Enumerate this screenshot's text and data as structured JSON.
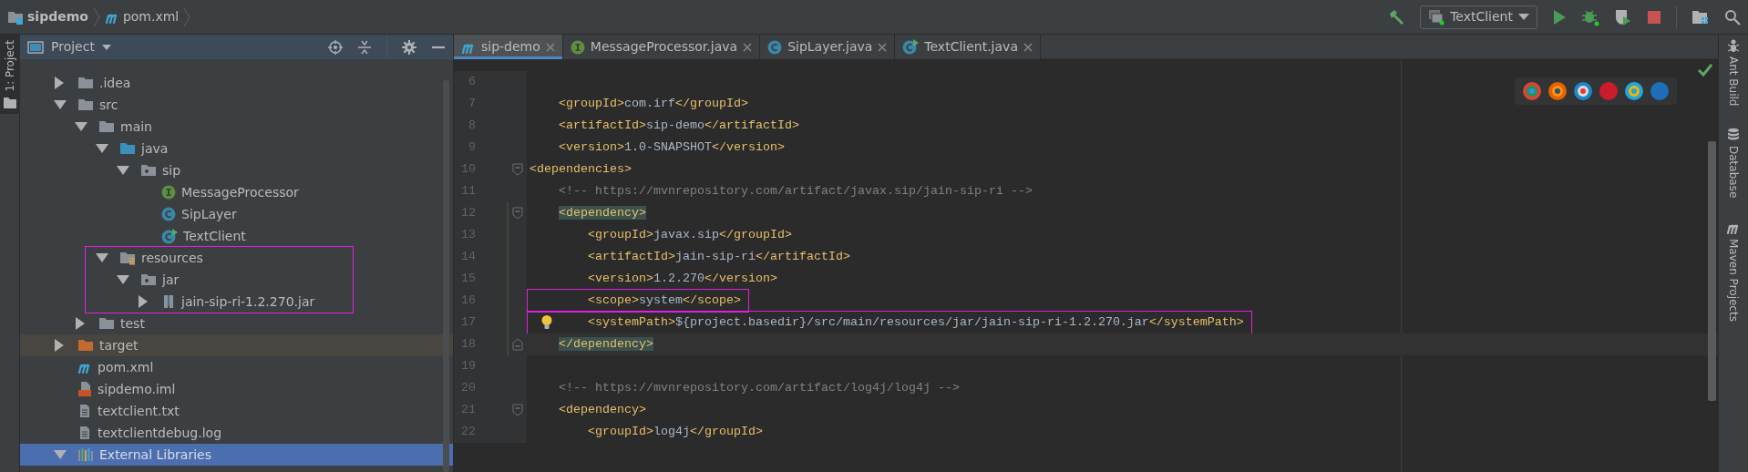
{
  "breadcrumbs": [
    {
      "label": "sipdemo",
      "kind": "project"
    },
    {
      "label": "pom.xml",
      "kind": "maven"
    }
  ],
  "toolbar": {
    "run_config": "TextClient"
  },
  "left_tool_windows": [
    {
      "label": "1: Project",
      "selected": true
    }
  ],
  "project_panel": {
    "title": "Project",
    "tree": [
      {
        "label": ".idea",
        "kind": "folder",
        "expanded": false,
        "selected": false
      },
      {
        "label": "src",
        "kind": "folder",
        "expanded": true,
        "selected": false,
        "children": [
          {
            "label": "main",
            "kind": "folder",
            "expanded": true,
            "selected": false,
            "children": [
              {
                "label": "java",
                "kind": "source-folder",
                "expanded": true,
                "selected": false,
                "children": [
                  {
                    "label": "sip",
                    "kind": "package",
                    "expanded": true,
                    "selected": false,
                    "children": [
                      {
                        "label": "MessageProcessor",
                        "kind": "interface",
                        "selected": false
                      },
                      {
                        "label": "SipLayer",
                        "kind": "class",
                        "selected": false
                      },
                      {
                        "label": "TextClient",
                        "kind": "main-class",
                        "selected": false
                      }
                    ]
                  }
                ]
              },
              {
                "label": "resources",
                "kind": "resources",
                "expanded": true,
                "selected": false,
                "marked": true,
                "children": [
                  {
                    "label": "jar",
                    "kind": "package",
                    "expanded": true,
                    "selected": false,
                    "children": [
                      {
                        "label": "jain-sip-ri-1.2.270.jar",
                        "kind": "jar",
                        "expanded": false,
                        "selected": false
                      }
                    ]
                  }
                ]
              }
            ]
          },
          {
            "label": "test",
            "kind": "folder",
            "expanded": false,
            "selected": false
          }
        ]
      },
      {
        "label": "target",
        "kind": "excluded-folder",
        "expanded": false,
        "selected": false
      },
      {
        "label": "pom.xml",
        "kind": "maven",
        "selected": false
      },
      {
        "label": "sipdemo.iml",
        "kind": "iml",
        "selected": false
      },
      {
        "label": "textclient.txt",
        "kind": "text",
        "selected": false
      },
      {
        "label": "textclientdebug.log",
        "kind": "text",
        "selected": false
      },
      {
        "label": "External Libraries",
        "kind": "library",
        "expanded": true,
        "selected": true
      }
    ]
  },
  "editor": {
    "tabs": [
      {
        "label": "sip-demo",
        "kind": "maven",
        "selected": true
      },
      {
        "label": "MessageProcessor.java",
        "kind": "interface",
        "selected": false
      },
      {
        "label": "SipLayer.java",
        "kind": "class",
        "selected": false
      },
      {
        "label": "TextClient.java",
        "kind": "main-class",
        "selected": false
      }
    ],
    "lines": [
      {
        "number": "6"
      },
      {
        "number": "7",
        "code": "    <groupId>com.irf</groupId>"
      },
      {
        "number": "8",
        "code": "    <artifactId>sip-demo</artifactId>"
      },
      {
        "number": "9",
        "code": "    <version>1.0-SNAPSHOT</version>"
      },
      {
        "number": "10",
        "code": "<dependencies>",
        "fold_start": true
      },
      {
        "number": "11",
        "code": "    <!-- https://mvnrepository.com/artifact/javax.sip/jain-sip-ri -->",
        "kind": "comment"
      },
      {
        "number": "12",
        "code": "    <dependency>",
        "fold_start": true,
        "brace_match": true,
        "vcs_changed": true
      },
      {
        "number": "13",
        "code": "        <groupId>javax.sip</groupId>",
        "vcs_changed": true
      },
      {
        "number": "14",
        "code": "        <artifactId>jain-sip-ri</artifactId>",
        "vcs_changed": true
      },
      {
        "number": "15",
        "code": "        <version>1.2.270</version>",
        "vcs_changed": true
      },
      {
        "number": "16",
        "code": "        <scope>system</scope>",
        "vcs_changed": true,
        "marked": true
      },
      {
        "number": "17",
        "code": "        <systemPath>${project.basedir}/src/main/resources/jar/jain-sip-ri-1.2.270.jar</systemPath>",
        "vcs_changed": true,
        "marked": true,
        "bulb": true
      },
      {
        "number": "18",
        "code": "    </dependency>",
        "fold_end": true,
        "brace_match": true,
        "vcs_changed": true,
        "current": true
      },
      {
        "number": "19"
      },
      {
        "number": "20",
        "code": "    <!-- https://mvnrepository.com/artifact/log4j/log4j -->",
        "kind": "comment"
      },
      {
        "number": "21",
        "code": "    <dependency>",
        "fold_start": true
      },
      {
        "number": "22",
        "code": "        <groupId>log4j</groupId>"
      }
    ]
  },
  "right_tool_windows": [
    {
      "label": "Ant Build",
      "kind": "ant"
    },
    {
      "label": "Database",
      "kind": "database"
    },
    {
      "label": "Maven Projects",
      "kind": "maven"
    }
  ]
}
